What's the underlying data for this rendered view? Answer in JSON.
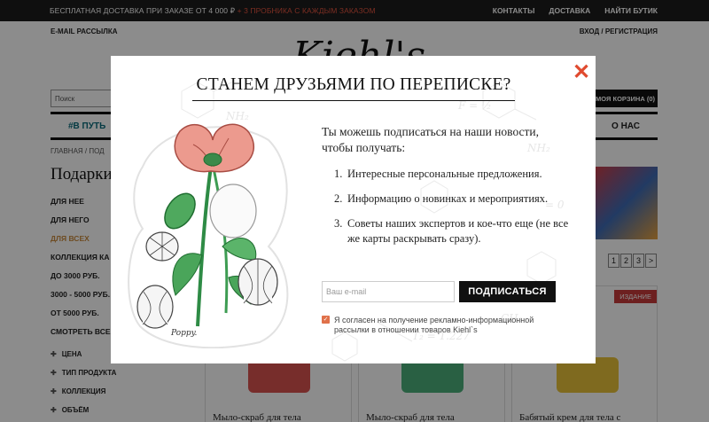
{
  "topbar": {
    "promo_main": "БЕСПЛАТНАЯ ДОСТАВКА ПРИ ЗАКАЗЕ ОТ 4 000 ₽",
    "promo_accent": "+ 3 ПРОБНИКА С КАЖДЫМ ЗАКАЗОМ",
    "links": [
      "КОНТАКТЫ",
      "ДОСТАВКА",
      "НАЙТИ БУТИК"
    ]
  },
  "subbar": {
    "newsletter": "E-MAIL РАССЫЛКА",
    "auth": "ВХОД / РЕГИСТРАЦИЯ"
  },
  "logo": "Kiehl's",
  "search": {
    "placeholder": "Поиск"
  },
  "cart": {
    "label": "МОЯ КОРЗИНА (0)"
  },
  "mainnav": {
    "item_left": "#В ПУТЬ",
    "item_right": "О НАС"
  },
  "breadcrumb": "ГЛАВНАЯ  /  ПОД",
  "page_title": "Подарки",
  "categories": [
    "ДЛЯ НЕЕ",
    "ДЛЯ НЕГО",
    "ДЛЯ ВСЕХ",
    "КОЛЛЕКЦИЯ КА",
    "ДО 3000 РУБ.",
    "3000 - 5000 РУБ.",
    "ОТ 5000 РУБ.",
    "СМОТРЕТЬ ВСЕ"
  ],
  "filters": [
    "ЦЕНА",
    "ТИП ПРОДУКТА",
    "КОЛЛЕКЦИЯ",
    "ОБЪЁМ"
  ],
  "pager": [
    "1",
    "2",
    "3",
    ">"
  ],
  "products": [
    {
      "name": "Мыло-скраб для тела"
    },
    {
      "name": "Мыло-скраб для тела"
    },
    {
      "name": "Бабятый крем для тела с",
      "badge": "ИЗДАНИЕ"
    }
  ],
  "modal": {
    "title": "СТАНЕМ ДРУЗЬЯМИ ПО ПЕРЕПИСКЕ?",
    "intro": "Ты можешь подписаться на наши новости, чтобы получать:",
    "benefits": [
      {
        "num": "1.",
        "text": "Интересные персональные предложения."
      },
      {
        "num": "2.",
        "text": "Информацию о новинках и мероприятиях."
      },
      {
        "num": "3.",
        "text": "Советы наших экспертов и кое-что еще (не все же карты раскрывать сразу)."
      }
    ],
    "email_placeholder": "Ваш e-mail",
    "subscribe_label": "ПОДПИСАТЬСЯ",
    "consent_text": "Я согласен на получение рекламно-информационной рассылки в отношении товаров Kiehl`s",
    "consent_checked": true,
    "illustration_caption": "Poppy.",
    "accent_color": "#e04a2f"
  }
}
